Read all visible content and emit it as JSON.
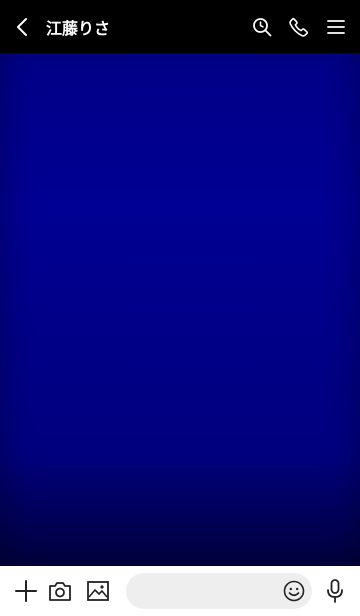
{
  "header": {
    "title": "江藤りさ",
    "icons": [
      "back-chevron-icon",
      "search-icon",
      "phone-icon",
      "menu-icon"
    ]
  },
  "chat": {
    "background_gradient": [
      "#000087",
      "#000092",
      "#00007e",
      "#00003c"
    ]
  },
  "input_bar": {
    "message_value": "",
    "message_placeholder": "",
    "icons": [
      "plus-icon",
      "camera-icon",
      "image-icon",
      "emoji-icon",
      "microphone-icon"
    ]
  },
  "colors": {
    "header_bg": "#000000",
    "header_text": "#ffffff",
    "input_bar_bg": "#ffffff",
    "field_bg": "#eeeeee",
    "icon_dark": "#222222"
  }
}
